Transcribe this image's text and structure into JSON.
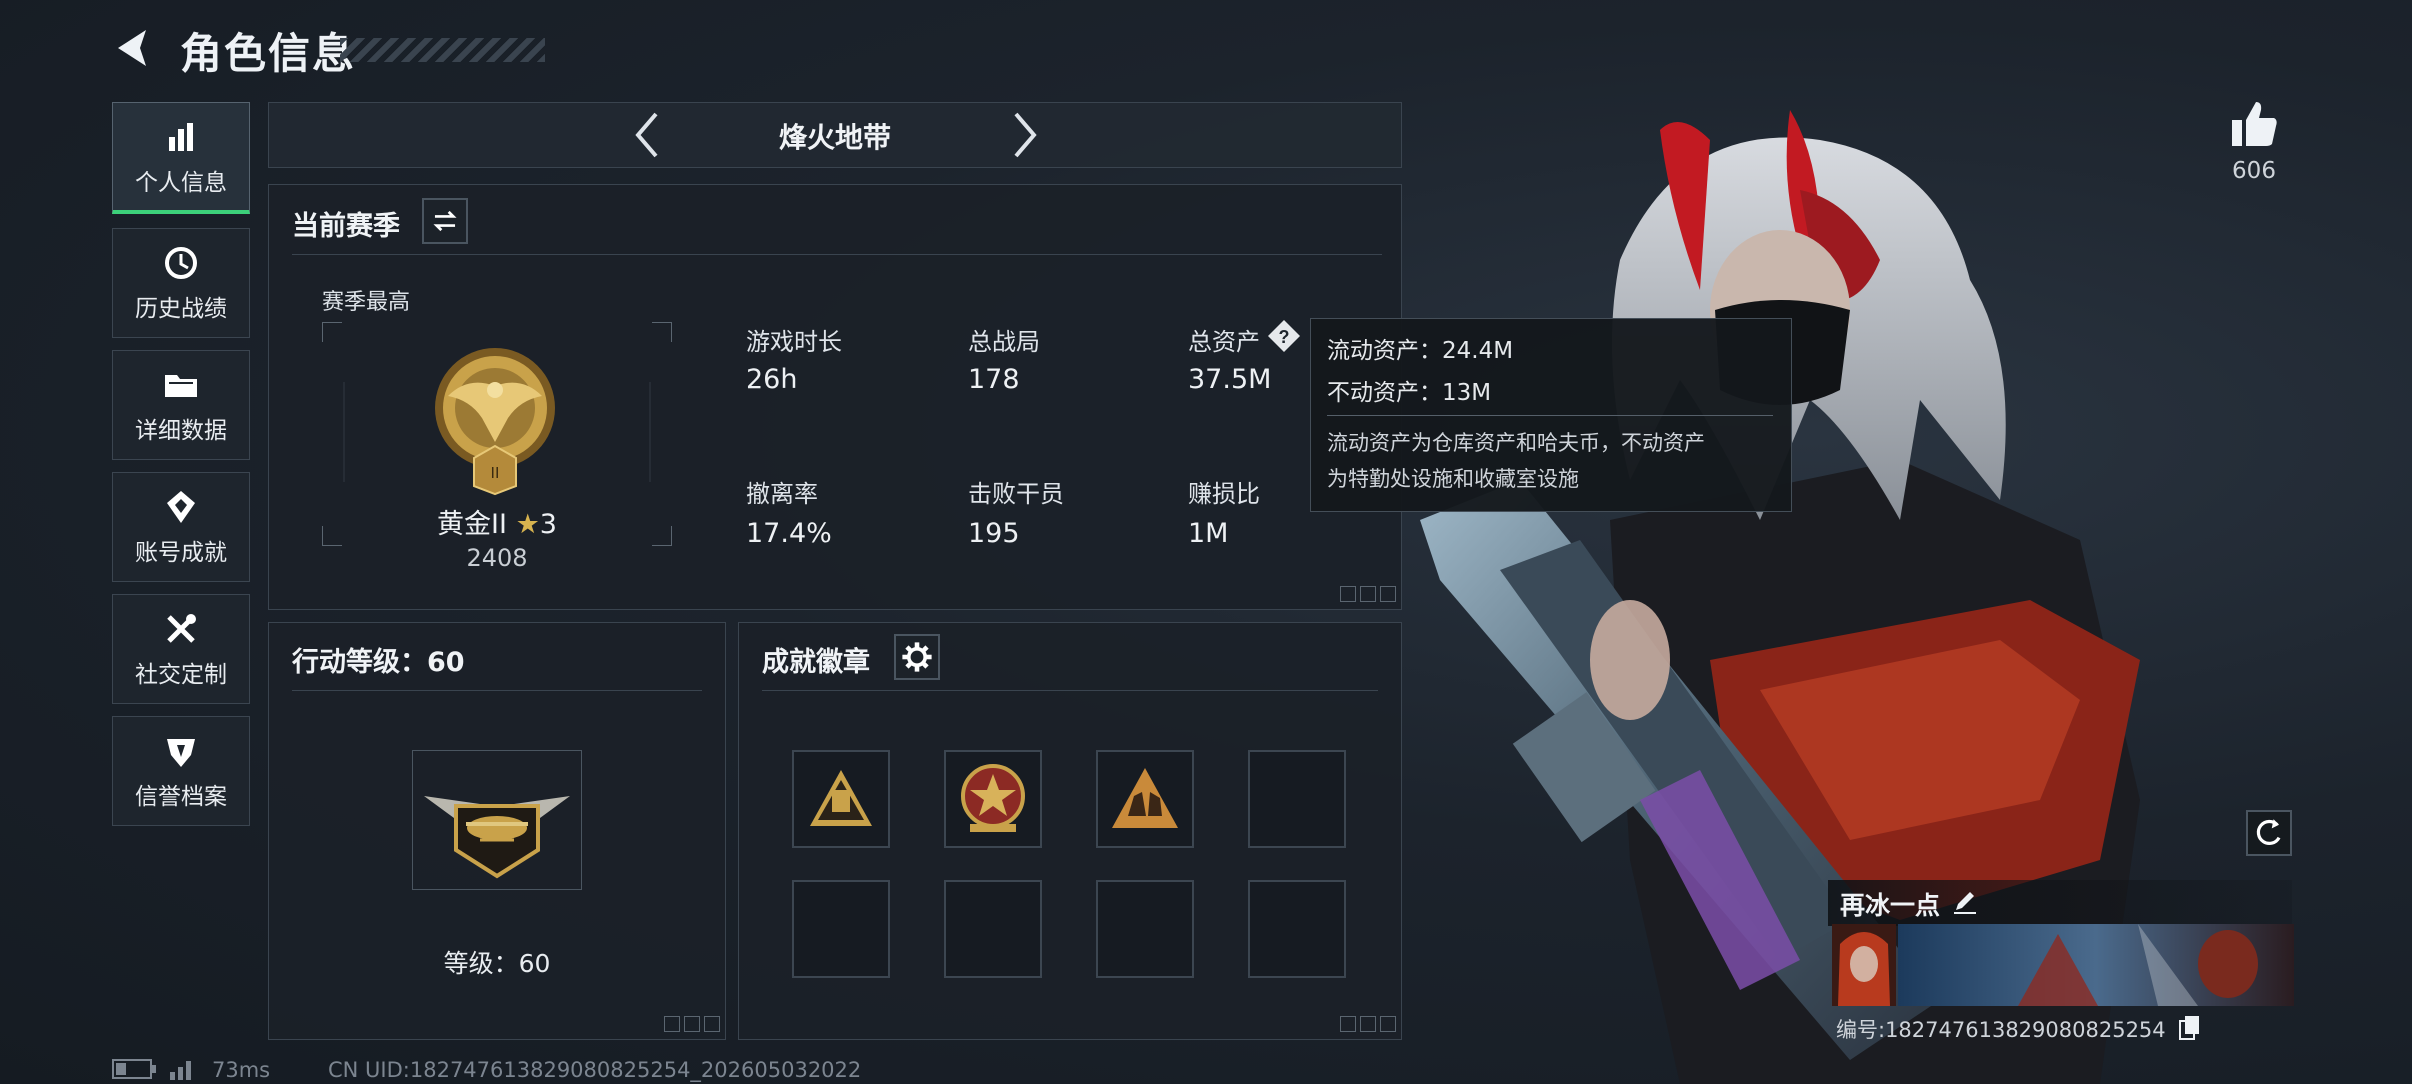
{
  "header": {
    "title": "角色信息"
  },
  "sidebar": {
    "items": [
      {
        "label": "个人信息",
        "icon": "bar-chart-icon",
        "active": true
      },
      {
        "label": "历史战绩",
        "icon": "history-icon"
      },
      {
        "label": "详细数据",
        "icon": "folder-icon"
      },
      {
        "label": "账号成就",
        "icon": "achievement-icon"
      },
      {
        "label": "社交定制",
        "icon": "tools-icon"
      },
      {
        "label": "信誉档案",
        "icon": "shield-icon"
      }
    ]
  },
  "mode_selector": {
    "label": "烽火地带"
  },
  "season": {
    "title": "当前赛季",
    "best_label": "赛季最高",
    "rank_name": "黄金II",
    "rank_stars": "3",
    "rank_score": "2408",
    "rank_badge_numeral": "II",
    "stats": [
      {
        "label": "游戏时长",
        "value": "26h"
      },
      {
        "label": "总战局",
        "value": "178"
      },
      {
        "label": "总资产",
        "value": "37.5M",
        "has_help": true
      },
      {
        "label": "撤离率",
        "value": "17.4%"
      },
      {
        "label": "击败干员",
        "value": "195"
      },
      {
        "label": "赚损比",
        "value": "1M"
      }
    ]
  },
  "tooltip": {
    "line1": "流动资产：24.4M",
    "line2": "不动资产：13M",
    "desc_line1": "流动资产为仓库资产和哈夫币，不动资产",
    "desc_line2": "为特勤处设施和收藏室设施"
  },
  "action_level": {
    "title": "行动等级：60",
    "level_text": "等级：60"
  },
  "badges": {
    "title": "成就徽章",
    "filled": [
      "hourglass-badge-icon",
      "star-emblem-badge-icon",
      "soldiers-badge-icon"
    ]
  },
  "likes": {
    "count": "606"
  },
  "player_card": {
    "name": "再冰一点",
    "id_text": "编号:1827476138290808252​54"
  },
  "status_bar": {
    "ping": "73ms",
    "uid": "CN UID:1827476138290808252​54_202605032022"
  },
  "colors": {
    "accent_green": "#3cd07a",
    "gold": "#c9a24a",
    "bg": "#1c232c"
  }
}
